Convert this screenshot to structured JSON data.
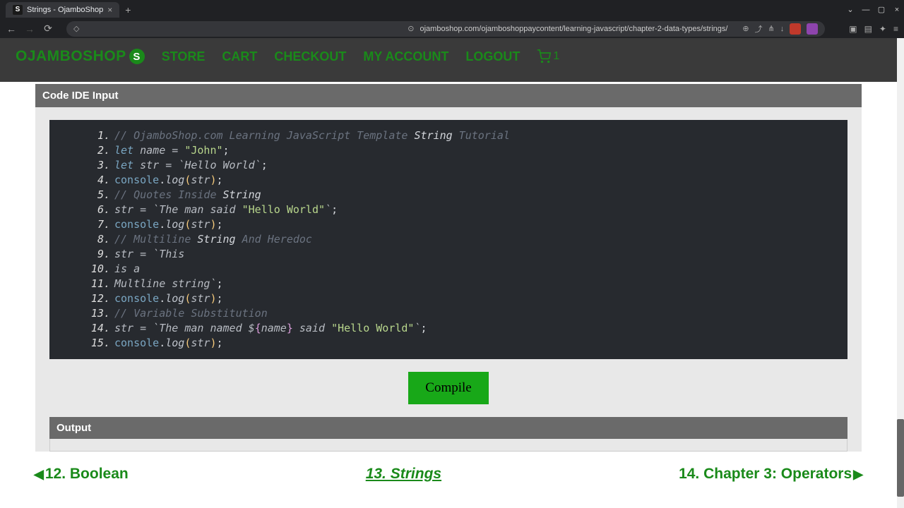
{
  "browser": {
    "tab_title": "Strings - OjamboShop",
    "url": "ojamboshop.com/ojamboshoppaycontent/learning-javascript/chapter-2-data-types/strings/"
  },
  "nav": {
    "logo": "OJAMBOSHOP",
    "logo_letter": "S",
    "links": [
      "STORE",
      "CART",
      "CHECKOUT",
      "MY ACCOUNT",
      "LOGOUT"
    ],
    "cart_count": "1"
  },
  "ide": {
    "header": "Code IDE Input",
    "compile": "Compile",
    "output_header": "Output"
  },
  "code_lines": [
    {
      "n": "1.",
      "segs": [
        {
          "t": "// OjamboShop.com Learning JavaScript Template",
          "c": "tok-comment"
        },
        {
          "t": " String ",
          "c": "tok-accent"
        },
        {
          "t": "Tutorial",
          "c": "tok-comment"
        }
      ]
    },
    {
      "n": "2.",
      "segs": [
        {
          "t": "let",
          "c": "tok-keyword"
        },
        {
          "t": " name = ",
          "c": "tok-op"
        },
        {
          "t": "\"John\"",
          "c": "tok-string"
        },
        {
          "t": ";",
          "c": "tok-punc"
        }
      ]
    },
    {
      "n": "3.",
      "segs": [
        {
          "t": "let",
          "c": "tok-keyword"
        },
        {
          "t": " str = ",
          "c": "tok-op"
        },
        {
          "t": "`Hello World`",
          "c": "tok-op"
        },
        {
          "t": ";",
          "c": "tok-punc"
        }
      ]
    },
    {
      "n": "4.",
      "segs": [
        {
          "t": "console",
          "c": "tok-console"
        },
        {
          "t": ".",
          "c": "tok-punc"
        },
        {
          "t": "log",
          "c": "tok-func"
        },
        {
          "t": "(",
          "c": "tok-paren"
        },
        {
          "t": "str",
          "c": "tok-var"
        },
        {
          "t": ")",
          "c": "tok-paren"
        },
        {
          "t": ";",
          "c": "tok-punc"
        }
      ]
    },
    {
      "n": "5.",
      "segs": [
        {
          "t": "// Quotes Inside",
          "c": "tok-comment"
        },
        {
          "t": " String",
          "c": "tok-accent"
        }
      ]
    },
    {
      "n": "6.",
      "segs": [
        {
          "t": "str = ",
          "c": "tok-op"
        },
        {
          "t": "`The man said ",
          "c": "tok-op"
        },
        {
          "t": "\"Hello World\"",
          "c": "tok-string"
        },
        {
          "t": "`",
          "c": "tok-op"
        },
        {
          "t": ";",
          "c": "tok-punc"
        }
      ]
    },
    {
      "n": "7.",
      "segs": [
        {
          "t": "console",
          "c": "tok-console"
        },
        {
          "t": ".",
          "c": "tok-punc"
        },
        {
          "t": "log",
          "c": "tok-func"
        },
        {
          "t": "(",
          "c": "tok-paren"
        },
        {
          "t": "str",
          "c": "tok-var"
        },
        {
          "t": ")",
          "c": "tok-paren"
        },
        {
          "t": ";",
          "c": "tok-punc"
        }
      ]
    },
    {
      "n": "8.",
      "segs": [
        {
          "t": "// Multiline",
          "c": "tok-comment"
        },
        {
          "t": " String ",
          "c": "tok-accent"
        },
        {
          "t": "And Heredoc",
          "c": "tok-comment"
        }
      ]
    },
    {
      "n": "9.",
      "segs": [
        {
          "t": "str = ",
          "c": "tok-op"
        },
        {
          "t": "`This",
          "c": "tok-op"
        }
      ]
    },
    {
      "n": "10.",
      "segs": [
        {
          "t": "is a",
          "c": "tok-op"
        }
      ]
    },
    {
      "n": "11.",
      "segs": [
        {
          "t": "Multline string`",
          "c": "tok-op"
        },
        {
          "t": ";",
          "c": "tok-punc"
        }
      ]
    },
    {
      "n": "12.",
      "segs": [
        {
          "t": "console",
          "c": "tok-console"
        },
        {
          "t": ".",
          "c": "tok-punc"
        },
        {
          "t": "log",
          "c": "tok-func"
        },
        {
          "t": "(",
          "c": "tok-paren"
        },
        {
          "t": "str",
          "c": "tok-var"
        },
        {
          "t": ")",
          "c": "tok-paren"
        },
        {
          "t": ";",
          "c": "tok-punc"
        }
      ]
    },
    {
      "n": "13.",
      "segs": [
        {
          "t": "// Variable Substitution",
          "c": "tok-comment"
        }
      ]
    },
    {
      "n": "14.",
      "segs": [
        {
          "t": "str = ",
          "c": "tok-op"
        },
        {
          "t": "`The man named $",
          "c": "tok-op"
        },
        {
          "t": "{",
          "c": "tok-brace"
        },
        {
          "t": "name",
          "c": "tok-var"
        },
        {
          "t": "}",
          "c": "tok-brace"
        },
        {
          "t": " said ",
          "c": "tok-op"
        },
        {
          "t": "\"Hello World\"",
          "c": "tok-string"
        },
        {
          "t": "`",
          "c": "tok-op"
        },
        {
          "t": ";",
          "c": "tok-punc"
        }
      ]
    },
    {
      "n": "15.",
      "segs": [
        {
          "t": "console",
          "c": "tok-console"
        },
        {
          "t": ".",
          "c": "tok-punc"
        },
        {
          "t": "log",
          "c": "tok-func"
        },
        {
          "t": "(",
          "c": "tok-paren"
        },
        {
          "t": "str",
          "c": "tok-var"
        },
        {
          "t": ")",
          "c": "tok-paren"
        },
        {
          "t": ";",
          "c": "tok-punc"
        }
      ]
    }
  ],
  "pagination": {
    "prev": "12. Boolean",
    "current": "13. Strings",
    "next": "14. Chapter 3: Operators"
  }
}
